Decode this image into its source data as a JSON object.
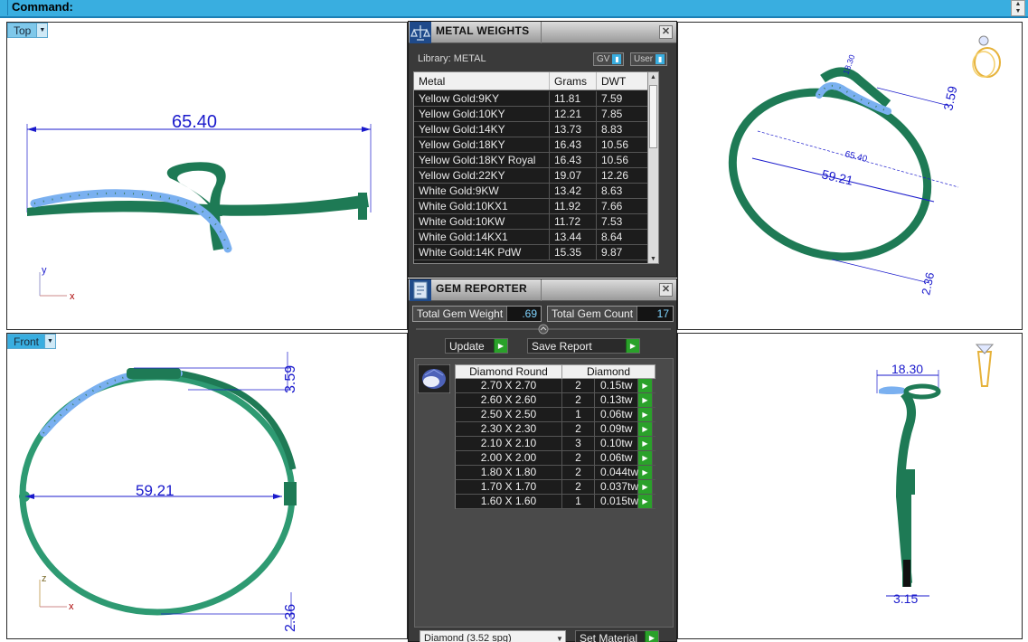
{
  "command_bar": {
    "label": "Command:"
  },
  "viewports": {
    "top": {
      "label": "Top",
      "dims": {
        "width": "65.40"
      },
      "axes": {
        "a": "y",
        "b": "x"
      }
    },
    "perspective": {
      "dims": {
        "major": "59.21",
        "minor": "65.40",
        "height": "3.59",
        "band": "2.36",
        "top": "18.30"
      }
    },
    "front": {
      "label": "Front",
      "dims": {
        "diameter": "59.21",
        "height": "3.59",
        "band": "2.36"
      },
      "axes": {
        "a": "z",
        "b": "x"
      }
    },
    "right": {
      "dims": {
        "top": "18.30",
        "bottom": "3.15"
      }
    }
  },
  "metal_weights": {
    "title": "METAL WEIGHTS",
    "library_label": "Library: METAL",
    "gv_label": "GV",
    "user_label": "User",
    "columns": [
      "Metal",
      "Grams",
      "DWT"
    ],
    "rows": [
      {
        "metal": "Yellow Gold:9KY",
        "grams": "11.81",
        "dwt": "7.59"
      },
      {
        "metal": "Yellow Gold:10KY",
        "grams": "12.21",
        "dwt": "7.85"
      },
      {
        "metal": "Yellow Gold:14KY",
        "grams": "13.73",
        "dwt": "8.83"
      },
      {
        "metal": "Yellow Gold:18KY",
        "grams": "16.43",
        "dwt": "10.56"
      },
      {
        "metal": "Yellow Gold:18KY Royal",
        "grams": "16.43",
        "dwt": "10.56"
      },
      {
        "metal": "Yellow Gold:22KY",
        "grams": "19.07",
        "dwt": "12.26"
      },
      {
        "metal": "White Gold:9KW",
        "grams": "13.42",
        "dwt": "8.63"
      },
      {
        "metal": "White Gold:10KX1",
        "grams": "11.92",
        "dwt": "7.66"
      },
      {
        "metal": "White Gold:10KW",
        "grams": "11.72",
        "dwt": "7.53"
      },
      {
        "metal": "White Gold:14KX1",
        "grams": "13.44",
        "dwt": "8.64"
      },
      {
        "metal": "White Gold:14K PdW",
        "grams": "15.35",
        "dwt": "9.87"
      }
    ]
  },
  "gem_reporter": {
    "title": "GEM REPORTER",
    "total_weight_label": "Total Gem Weight",
    "total_weight_value": ".69",
    "total_count_label": "Total Gem Count",
    "total_count_value": "17",
    "update_label": "Update",
    "save_report_label": "Save Report",
    "columns": [
      "Diamond Round",
      "Diamond"
    ],
    "rows": [
      {
        "size": "2.70 X 2.70",
        "qty": "2",
        "wt": "0.15tw"
      },
      {
        "size": "2.60 X 2.60",
        "qty": "2",
        "wt": "0.13tw"
      },
      {
        "size": "2.50 X 2.50",
        "qty": "1",
        "wt": "0.06tw"
      },
      {
        "size": "2.30 X 2.30",
        "qty": "2",
        "wt": "0.09tw"
      },
      {
        "size": "2.10 X 2.10",
        "qty": "3",
        "wt": "0.10tw"
      },
      {
        "size": "2.00 X 2.00",
        "qty": "2",
        "wt": "0.06tw"
      },
      {
        "size": "1.80 X 1.80",
        "qty": "2",
        "wt": "0.044tw"
      },
      {
        "size": "1.70 X 1.70",
        "qty": "2",
        "wt": "0.037tw"
      },
      {
        "size": "1.60 X 1.60",
        "qty": "1",
        "wt": "0.015tw"
      }
    ],
    "material_select": "Diamond     (3.52 spg)",
    "set_material_label": "Set Material"
  },
  "colors": {
    "accent": "#39aee0",
    "metal": "#1e7a55",
    "dimension": "#1a1acc",
    "gem": "#7ab0f0"
  }
}
